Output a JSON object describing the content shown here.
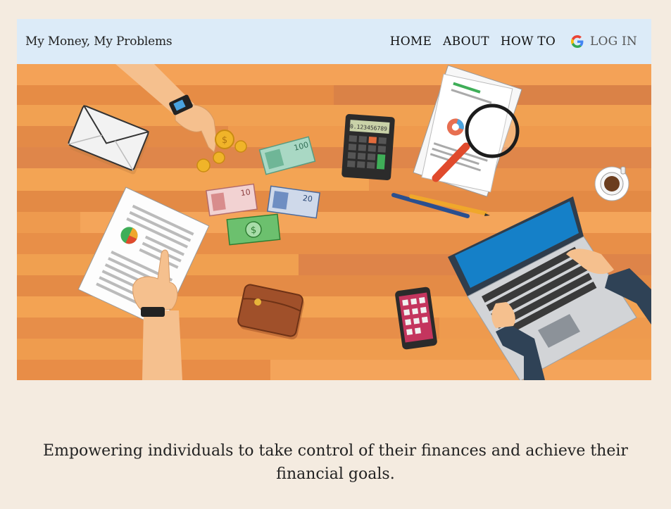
{
  "header": {
    "brand": "My Money, My Problems",
    "nav": [
      {
        "label": "HOME"
      },
      {
        "label": "ABOUT"
      },
      {
        "label": "HOW TO"
      }
    ],
    "login": {
      "label": "LOG IN",
      "icon": "google-icon"
    }
  },
  "hero": {
    "calculator_display": "0.123456789",
    "banknotes": [
      "100",
      "10",
      "20"
    ]
  },
  "tagline": "Empowering individuals to take control of their finances and achieve their financial goals.",
  "colors": {
    "background": "#f4ebe0",
    "navbar": "#dcebf8",
    "desk": "#ee9a4e"
  }
}
